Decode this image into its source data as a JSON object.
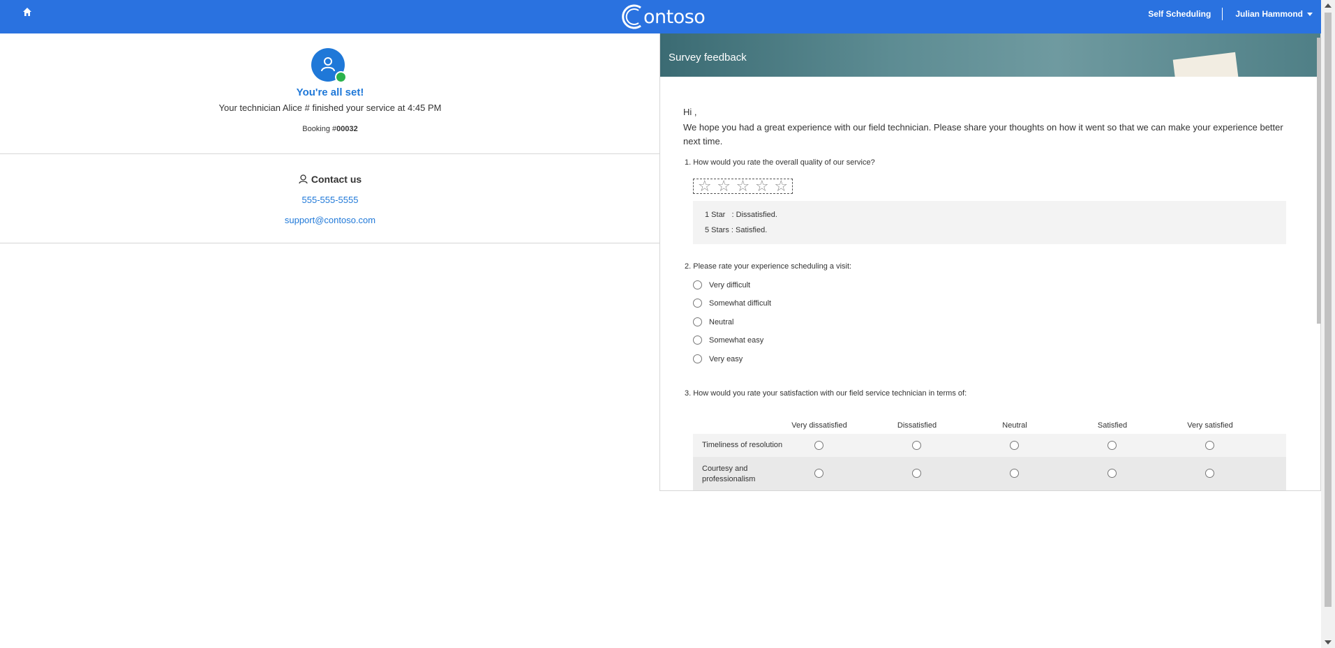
{
  "topbar": {
    "brand": "ontoso",
    "nav_link": "Self Scheduling",
    "user_name": "Julian Hammond",
    "accent": "#2a72e0"
  },
  "status": {
    "title": "You're all set!",
    "message": "Your technician Alice # finished your service at 4:45 PM",
    "booking_label": "Booking #",
    "booking_number": "00032"
  },
  "contact": {
    "title": "Contact us",
    "phone": "555-555-5555",
    "email": "support@contoso.com"
  },
  "survey": {
    "title": "Survey feedback",
    "greeting": "Hi ,",
    "intro": "We hope you had a great experience with our field technician. Please share your thoughts on how it went so that we can make your experience better next time.",
    "q1": "1. How would you rate the overall quality of our service?",
    "stars_selected": 0,
    "legend_1": "1 Star   : Dissatisfied.",
    "legend_2": "5 Stars : Satisfied.",
    "q2": "2. Please rate your experience scheduling a visit:",
    "q2_options": [
      "Very difficult",
      "Somewhat difficult",
      "Neutral",
      "Somewhat easy",
      "Very easy"
    ],
    "q3": "3. How would you rate your satisfaction with our field service technician in terms of:",
    "q3_columns": [
      "Very dissatisfied",
      "Dissatisfied",
      "Neutral",
      "Satisfied",
      "Very satisfied"
    ],
    "q3_rows": [
      "Timeliness of resolution",
      "Courtesy and professionalism"
    ]
  }
}
